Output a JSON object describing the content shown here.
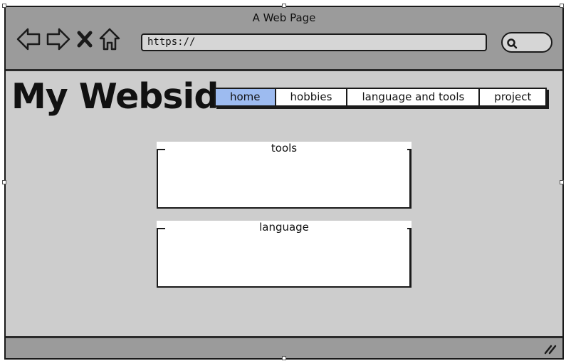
{
  "window": {
    "title": "A Web Page"
  },
  "browser": {
    "url_text": "https://",
    "nav_icons": [
      "back-arrow-icon",
      "forward-arrow-icon",
      "close-icon",
      "home-icon"
    ],
    "search_icon": "search-icon"
  },
  "site": {
    "title": "My Webside"
  },
  "menu": {
    "items": [
      {
        "label": "home",
        "active": true
      },
      {
        "label": "hobbies",
        "active": false
      },
      {
        "label": "language and tools",
        "active": false
      },
      {
        "label": "project",
        "active": false
      }
    ]
  },
  "panels": [
    {
      "title": "tools"
    },
    {
      "title": "language"
    }
  ],
  "colors": {
    "chrome": "#9b9b9b",
    "page_background": "#cdcdcd",
    "active_tab": "#9dbbf0",
    "stroke": "#1a1a1a"
  }
}
